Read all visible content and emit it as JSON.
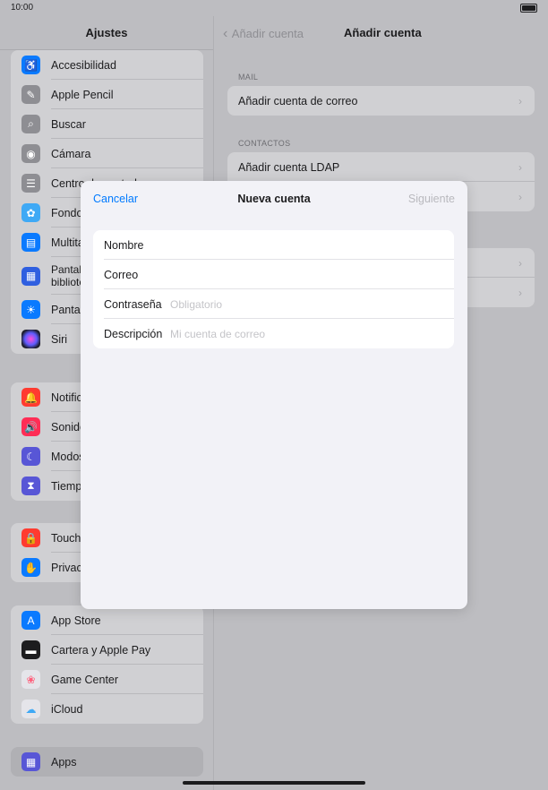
{
  "status": {
    "time": "10:00"
  },
  "sidebar": {
    "title": "Ajustes",
    "groups": [
      {
        "items": [
          {
            "label": "Accesibilidad",
            "icon": "accessibility-icon",
            "color": "#0a7aff",
            "glyph": "♿"
          },
          {
            "label": "Apple Pencil",
            "icon": "pencil-icon",
            "color": "#8e8e93",
            "glyph": "✎"
          },
          {
            "label": "Buscar",
            "icon": "search-icon",
            "color": "#8e8e93",
            "glyph": "⌕"
          },
          {
            "label": "Cámara",
            "icon": "camera-icon",
            "color": "#8e8e93",
            "glyph": "◉"
          },
          {
            "label": "Centro de control",
            "icon": "control-center-icon",
            "color": "#8e8e93",
            "glyph": "☰"
          },
          {
            "label": "Fondo de pantalla",
            "icon": "wallpaper-icon",
            "color": "#3fa9f5",
            "glyph": "✿"
          },
          {
            "label": "Multitarea y gestos",
            "icon": "multitasking-icon",
            "color": "#0a7aff",
            "glyph": "▤"
          },
          {
            "label": "Pantalla de inicio y biblioteca de apps",
            "icon": "home-screen-icon",
            "color": "#2f5fe0",
            "glyph": "▦"
          },
          {
            "label": "Pantalla y brillo",
            "icon": "brightness-icon",
            "color": "#0a7aff",
            "glyph": "☀"
          },
          {
            "label": "Siri",
            "icon": "siri-icon",
            "color": "#2c2c3a",
            "glyph": "●"
          }
        ]
      },
      {
        "items": [
          {
            "label": "Notificaciones",
            "icon": "notifications-icon",
            "color": "#ff3b30",
            "glyph": "●"
          },
          {
            "label": "Sonidos",
            "icon": "sounds-icon",
            "color": "#ff2d55",
            "glyph": "◀"
          },
          {
            "label": "Modos de concentración",
            "icon": "focus-icon",
            "color": "#5856d6",
            "glyph": "☾"
          },
          {
            "label": "Tiempo de uso",
            "icon": "screen-time-icon",
            "color": "#5856d6",
            "glyph": "⧗"
          }
        ]
      },
      {
        "items": [
          {
            "label": "Touch ID y código",
            "icon": "touch-id-icon",
            "color": "#ff3b30",
            "glyph": "🔒"
          },
          {
            "label": "Privacidad y seguridad",
            "icon": "privacy-icon",
            "color": "#0a7aff",
            "glyph": "✋"
          }
        ]
      },
      {
        "items": [
          {
            "label": "App Store",
            "icon": "app-store-icon",
            "color": "#0a7aff",
            "glyph": "A"
          },
          {
            "label": "Cartera y Apple Pay",
            "icon": "wallet-icon",
            "color": "#1c1c1e",
            "glyph": "▬"
          },
          {
            "label": "Game Center",
            "icon": "game-center-icon",
            "color": "#e5e5ea",
            "glyph": "❀"
          },
          {
            "label": "iCloud",
            "icon": "icloud-icon",
            "color": "#e5e5ea",
            "glyph": "☁"
          }
        ]
      },
      {
        "items": [
          {
            "label": "Apps",
            "icon": "apps-icon",
            "color": "#5856d6",
            "glyph": "▦"
          }
        ]
      }
    ]
  },
  "detail": {
    "back_label": "Añadir cuenta",
    "title": "Añadir cuenta",
    "sections": [
      {
        "header": "MAIL",
        "items": [
          "Añadir cuenta de correo"
        ]
      },
      {
        "header": "CONTACTOS",
        "items": [
          "Añadir cuenta LDAP",
          ""
        ]
      },
      {
        "header": "",
        "items": [
          "",
          ""
        ]
      }
    ]
  },
  "modal": {
    "cancel_label": "Cancelar",
    "title": "Nueva cuenta",
    "next_label": "Siguiente",
    "fields": [
      {
        "label": "Nombre",
        "value": "",
        "placeholder": ""
      },
      {
        "label": "Correo",
        "value": "",
        "placeholder": ""
      },
      {
        "label": "Contraseña",
        "value": "",
        "placeholder": "Obligatorio"
      },
      {
        "label": "Descripción",
        "value": "",
        "placeholder": "Mi cuenta de correo"
      }
    ]
  }
}
